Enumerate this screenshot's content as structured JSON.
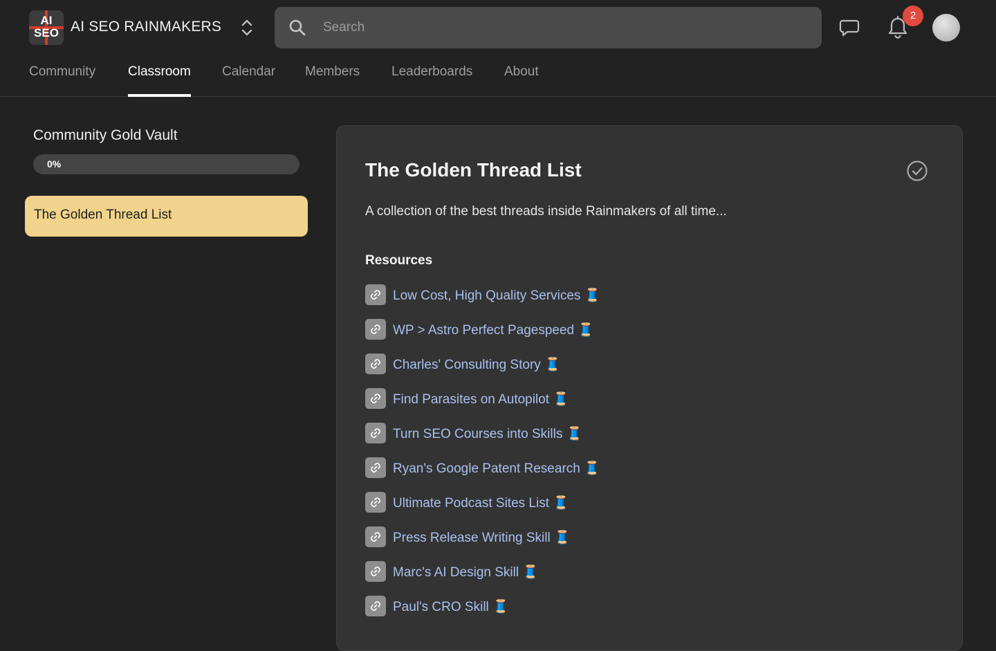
{
  "header": {
    "logo": {
      "line1": "AI",
      "line2": "SEO"
    },
    "brand": "AI SEO RAINMAKERS",
    "search_placeholder": "Search",
    "notification_count": "2"
  },
  "nav": {
    "tabs": [
      {
        "label": "Community"
      },
      {
        "label": "Classroom",
        "active": true
      },
      {
        "label": "Calendar"
      },
      {
        "label": "Members"
      },
      {
        "label": "Leaderboards"
      },
      {
        "label": "About"
      }
    ]
  },
  "sidebar": {
    "course_title": "Community Gold Vault",
    "progress_label": "0%",
    "progress_value": 0,
    "lessons": [
      {
        "label": "The Golden Thread List",
        "selected": true
      }
    ]
  },
  "main": {
    "title": "The Golden Thread List",
    "description": "A collection of the best threads inside Rainmakers of all time...",
    "resources_heading": "Resources",
    "resources": [
      {
        "label": "Low Cost, High Quality Services 🧵"
      },
      {
        "label": "WP > Astro Perfect Pagespeed 🧵"
      },
      {
        "label": "Charles' Consulting Story 🧵"
      },
      {
        "label": "Find Parasites on Autopilot 🧵"
      },
      {
        "label": "Turn SEO Courses into Skills 🧵"
      },
      {
        "label": "Ryan's Google Patent Research 🧵"
      },
      {
        "label": "Ultimate Podcast Sites List 🧵"
      },
      {
        "label": "Press Release Writing Skill 🧵"
      },
      {
        "label": "Marc's AI Design Skill 🧵"
      },
      {
        "label": "Paul's CRO Skill 🧵"
      }
    ]
  },
  "colors": {
    "background": "#222222",
    "panel": "#333333",
    "accent_lesson": "#f1d38b",
    "link": "#a9c0ee",
    "badge": "#e04a3f"
  }
}
